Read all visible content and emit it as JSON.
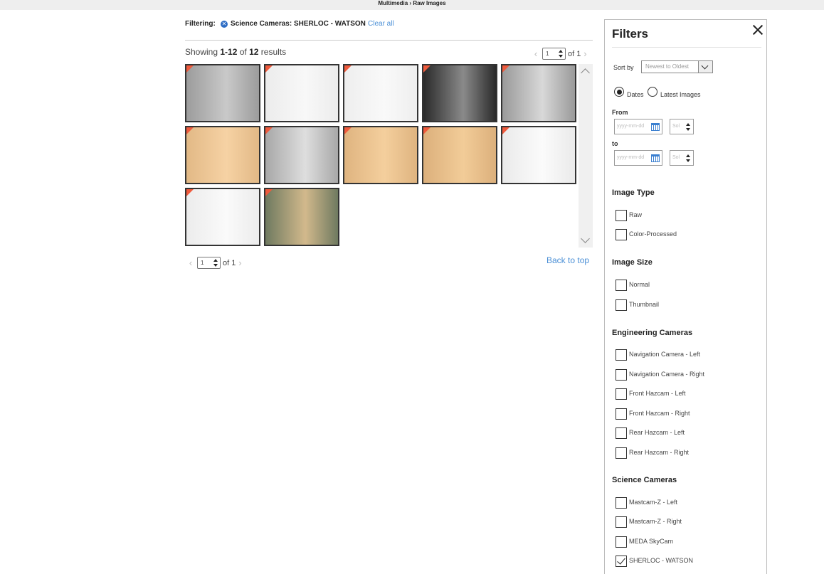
{
  "breadcrumb": "Multimedia › Raw Images",
  "filtering": {
    "label": "Filtering:",
    "chip": "Science Cameras: SHERLOC - WATSON",
    "clear": "Clear all"
  },
  "results": {
    "prefix": "Showing ",
    "range": "1-12",
    "of": " of ",
    "total": "12",
    "suffix": " results"
  },
  "pager": {
    "page": "1",
    "of_text": "of 1"
  },
  "back_to_top": "Back to top",
  "gallery": [
    {
      "color1": "#9c9c9c",
      "color2": "#c9c9c9"
    },
    {
      "color1": "#ececec",
      "color2": "#f8f8f8"
    },
    {
      "color1": "#eeeeee",
      "color2": "#f9f9f9"
    },
    {
      "color1": "#2a2a2a",
      "color2": "#8a8a8a"
    },
    {
      "color1": "#9a9a9a",
      "color2": "#d8d8d8"
    },
    {
      "color1": "#e2b986",
      "color2": "#f6d2a4"
    },
    {
      "color1": "#a8a8a8",
      "color2": "#dedede"
    },
    {
      "color1": "#dfb480",
      "color2": "#f4cf9d"
    },
    {
      "color1": "#dcb07c",
      "color2": "#f2cc98"
    },
    {
      "color1": "#eaeaea",
      "color2": "#fbfbfb"
    },
    {
      "color1": "#ececec",
      "color2": "#fafafa"
    },
    {
      "color1": "#6f7a60",
      "color2": "#d2b98c"
    }
  ],
  "filters": {
    "title": "Filters",
    "sort_label": "Sort by",
    "sort_value": "Newest to Oldest",
    "mode_dates": "Dates",
    "mode_latest": "Latest Images",
    "from_label": "From",
    "to_label": "to",
    "date_placeholder": "yyyy-mm-dd",
    "sol_placeholder": "Sol",
    "image_type": {
      "title": "Image Type",
      "options": [
        {
          "label": "Raw",
          "checked": false
        },
        {
          "label": "Color-Processed",
          "checked": false
        }
      ]
    },
    "image_size": {
      "title": "Image Size",
      "options": [
        {
          "label": "Normal",
          "checked": false
        },
        {
          "label": "Thumbnail",
          "checked": false
        }
      ]
    },
    "engineering": {
      "title": "Engineering Cameras",
      "options": [
        {
          "label": "Navigation Camera - Left",
          "checked": false
        },
        {
          "label": "Navigation Camera - Right",
          "checked": false
        },
        {
          "label": "Front Hazcam - Left",
          "checked": false
        },
        {
          "label": "Front Hazcam - Right",
          "checked": false
        },
        {
          "label": "Rear Hazcam - Left",
          "checked": false
        },
        {
          "label": "Rear Hazcam - Right",
          "checked": false
        }
      ]
    },
    "science": {
      "title": "Science Cameras",
      "options": [
        {
          "label": "Mastcam-Z - Left",
          "checked": false
        },
        {
          "label": "Mastcam-Z - Right",
          "checked": false
        },
        {
          "label": "MEDA SkyCam",
          "checked": false
        },
        {
          "label": "SHERLOC - WATSON",
          "checked": true
        }
      ]
    }
  }
}
